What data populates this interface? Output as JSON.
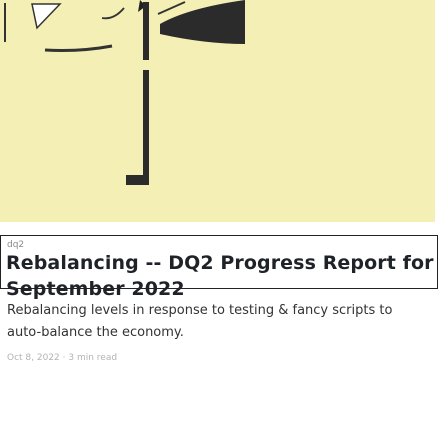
{
  "post": {
    "tag": "dq2",
    "title": "Rebalancing -- DQ2 Progress Report for September 2022",
    "summary": "Rebalancing levels in response to testing & fancy scripts to auto-balance the economy.",
    "meta": "Oct 8, 2022 · 3 min read"
  },
  "colors": {
    "hero_background": "#f4efb5",
    "ink": "#1f2328",
    "muted": "#8a8a8a"
  }
}
